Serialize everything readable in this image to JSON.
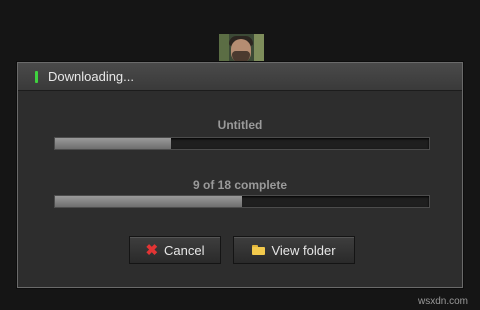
{
  "dialog": {
    "title": "Downloading...",
    "status_icon": "green-indicator",
    "file_label": "Untitled",
    "file_progress": 0.31,
    "overall_label": "9 of 18 complete",
    "overall_progress": 0.5,
    "buttons": {
      "cancel_label": "Cancel",
      "cancel_icon": "close-x-icon",
      "view_label": "View folder",
      "view_icon": "folder-icon"
    },
    "accent_color": "#3fd23f",
    "cancel_icon_color": "#e23434",
    "folder_icon_color": "#f2c94c"
  },
  "watermark": "wsxdn.com"
}
